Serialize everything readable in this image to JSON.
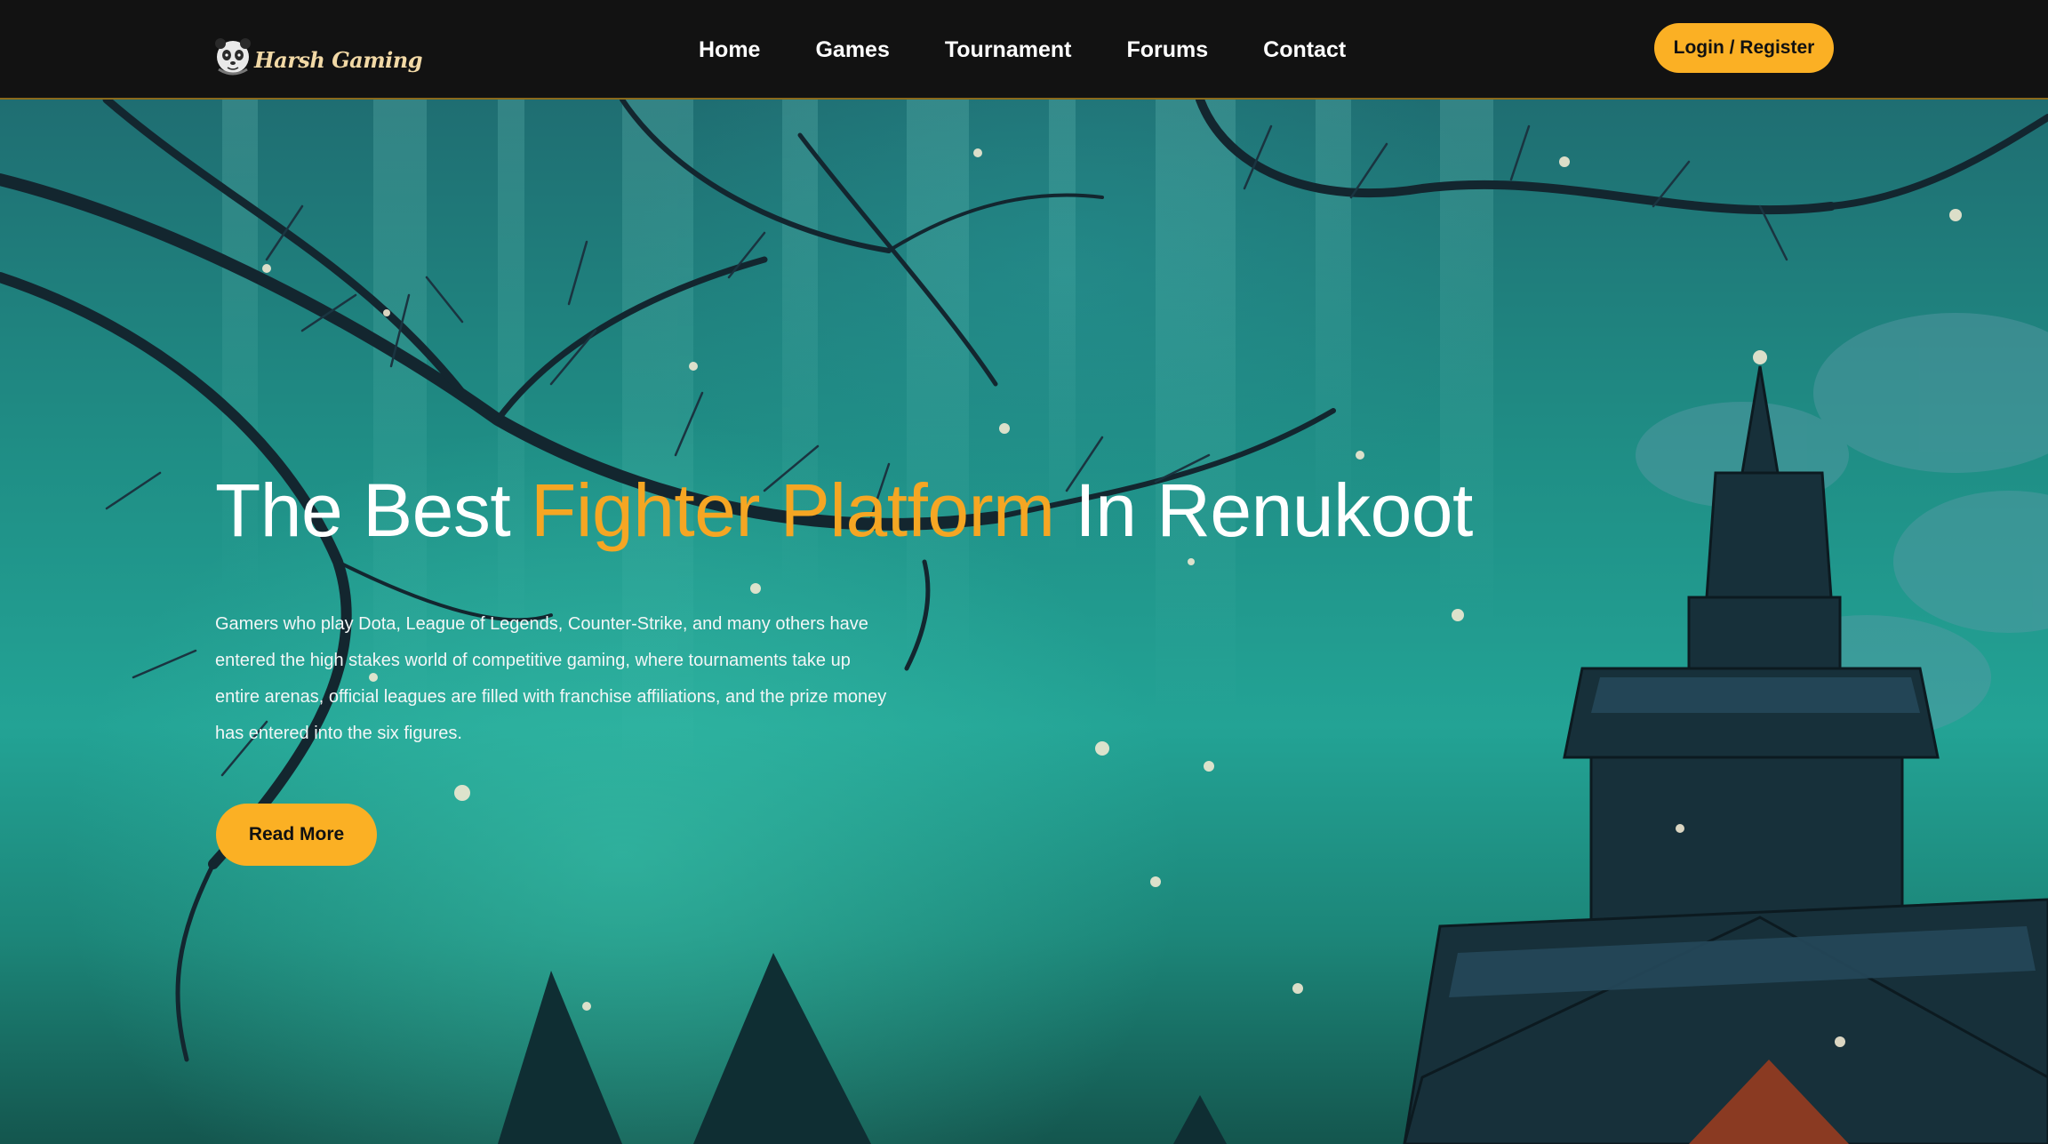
{
  "brand": {
    "name": "Harsh Gaming",
    "logo_icon": "panda-face-icon"
  },
  "nav": {
    "items": [
      {
        "label": "Home"
      },
      {
        "label": "Games"
      },
      {
        "label": "Tournament"
      },
      {
        "label": "Forums"
      },
      {
        "label": "Contact"
      }
    ],
    "login_label": "Login / Register"
  },
  "hero": {
    "title_part1": "The Best ",
    "title_accent": "Fighter Platform",
    "title_part2": " In Renukoot",
    "description": "Gamers who play Dota, League of Legends, Counter-Strike, and many others have entered the high stakes world of competitive gaming, where tournaments take up entire arenas, official leagues are filled with franchise affiliations, and the prize money has entered into the six figures.",
    "cta_label": "Read More"
  },
  "colors": {
    "navbar_bg": "#121212",
    "accent": "#fbb024",
    "title_accent": "#f5a623",
    "text": "#ffffff"
  }
}
